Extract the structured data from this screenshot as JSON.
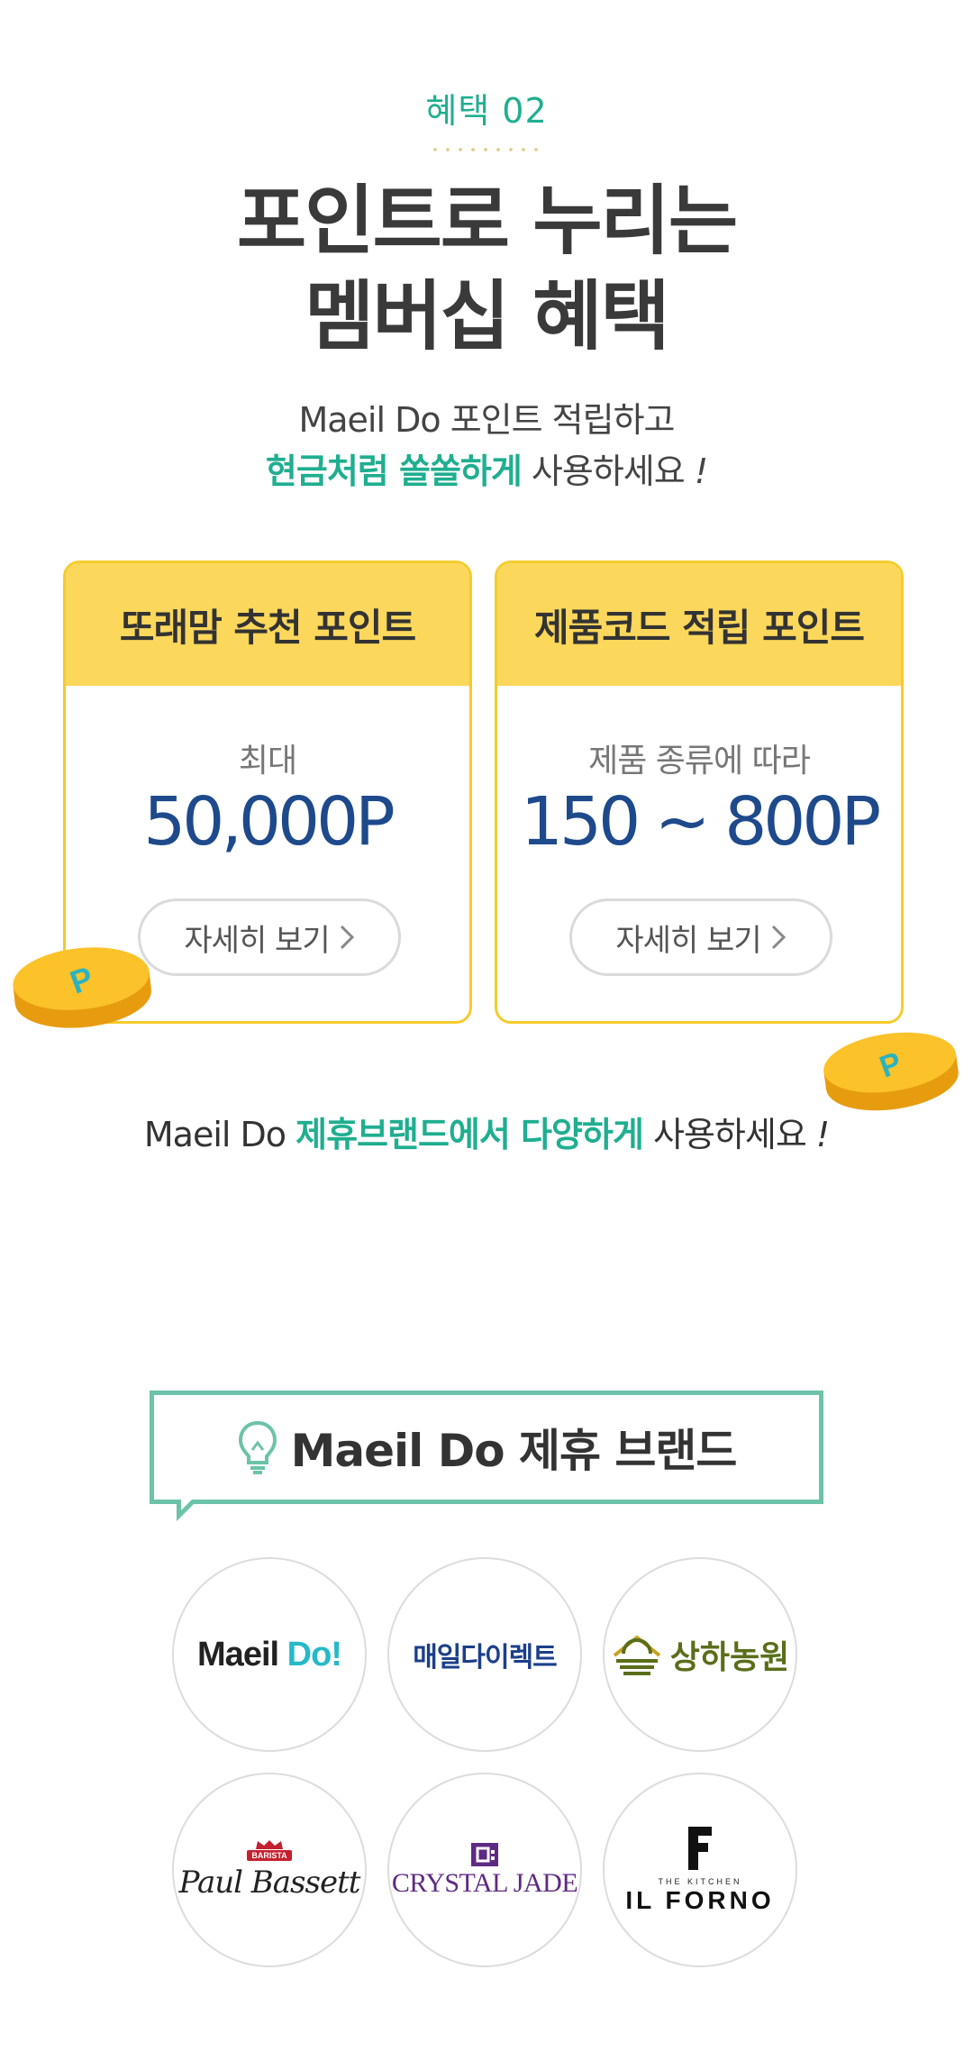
{
  "header": {
    "eyebrow": "혜택 02",
    "title_line1": "포인트로 누리는",
    "title_line2": "멤버십 혜택",
    "sub1": "Maeil Do 포인트 적립하고",
    "sub2_highlight": "현금처럼 쏠쏠하게",
    "sub2_rest": " 사용하세요",
    "sub2_excl": "!"
  },
  "cards": [
    {
      "title": "또래맘 추천 포인트",
      "caption": "최대",
      "value": "50,000P",
      "button": "자세히 보기"
    },
    {
      "title": "제품코드 적립 포인트",
      "caption": "제품 종류에 따라",
      "value": "150 ~ 800P",
      "button": "자세히 보기"
    }
  ],
  "coin": {
    "letter": "P",
    "color": "#f8b81c",
    "letter_color": "#2bb3c0"
  },
  "brand_line": {
    "prefix": "Maeil Do ",
    "highlight": "제휴브랜드에서 다양하게",
    "suffix": " 사용하세요",
    "excl": "!"
  },
  "partner_box": {
    "title": "Maeil Do 제휴 브랜드",
    "icon": "lightbulb-icon"
  },
  "partners": {
    "maeil_do": {
      "main": "Maeil ",
      "accent": "Do!"
    },
    "maeil_direct": "매일다이렉트",
    "sangha": "상하농원",
    "paul_bassett": {
      "badge": "BARISTA",
      "name": "Paul Bassett"
    },
    "crystal_jade": "CRYSTAL JADE",
    "il_forno": {
      "small": "THE KITCHEN",
      "big": "IL FORNO"
    }
  },
  "colors": {
    "accent_green": "#1fae90",
    "card_border": "#f5cb2c",
    "card_header": "#fbd75b",
    "value_blue": "#1e4a8c",
    "box_border": "#6cc3a9"
  }
}
